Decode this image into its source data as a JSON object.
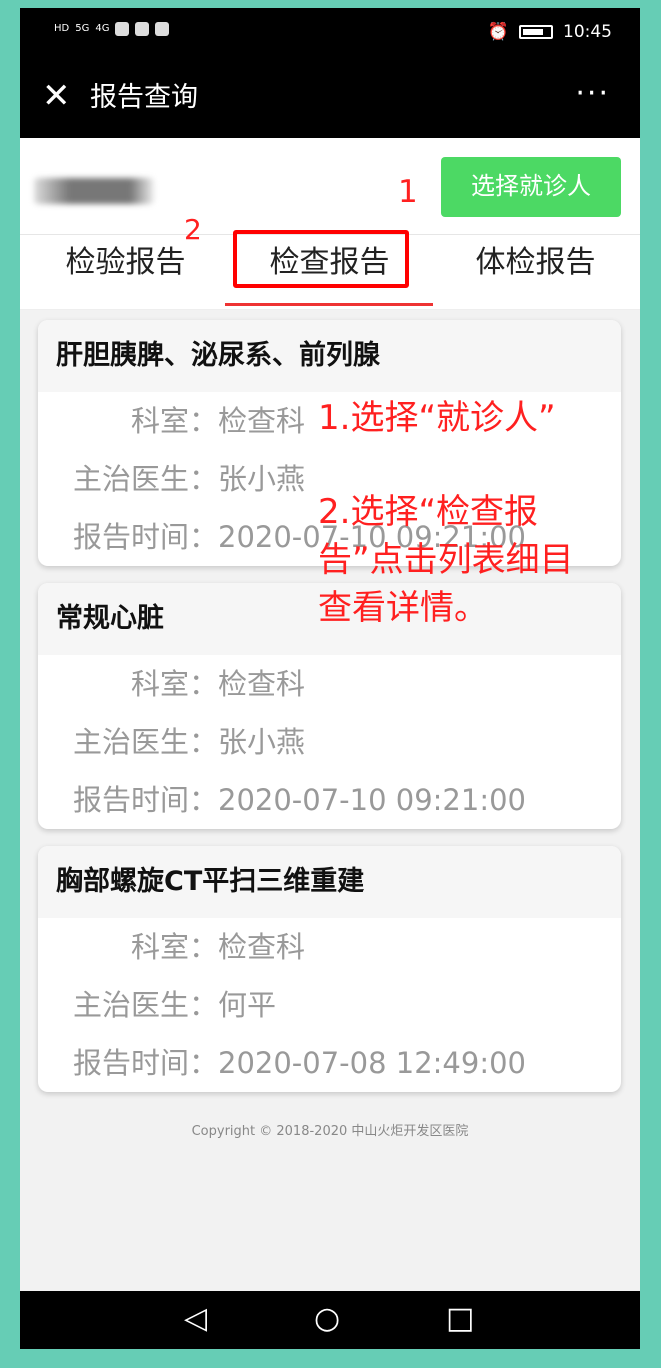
{
  "status_bar": {
    "left_icons": [
      "HD",
      "5G",
      "4G",
      "app",
      "app",
      "app"
    ],
    "time": "10:45",
    "alarm_icon": "alarm-icon"
  },
  "title_bar": {
    "close": "✕",
    "title": "报告查询",
    "more": "···"
  },
  "patient": {
    "select_button": "选择就诊人"
  },
  "annotations": {
    "num1": "1",
    "num2": "2",
    "note1": "1.选择“就诊人”",
    "note2_line1": "2.选择“检查报",
    "note2_line2": "告”点击列表细目",
    "note2_line3": "查看详情。"
  },
  "tabs": [
    "检验报告",
    "检查报告",
    "体检报告"
  ],
  "reports": [
    {
      "title": "肝胆胰脾、泌尿系、前列腺",
      "dept_label": "科室：",
      "dept": "检查科",
      "doctor_label": "主治医生：",
      "doctor": "张小燕",
      "time_label": "报告时间：",
      "time": "2020-07-10 09:21:00"
    },
    {
      "title": "常规心脏",
      "dept_label": "科室：",
      "dept": "检查科",
      "doctor_label": "主治医生：",
      "doctor": "张小燕",
      "time_label": "报告时间：",
      "time": "2020-07-10 09:21:00"
    },
    {
      "title": "胸部螺旋CT平扫三维重建",
      "dept_label": "科室：",
      "dept": "检查科",
      "doctor_label": "主治医生：",
      "doctor": "何平",
      "time_label": "报告时间：",
      "time": "2020-07-08 12:49:00"
    }
  ],
  "copyright": "Copyright © 2018-2020 中山火炬开发区医院",
  "nav": {
    "back": "◁",
    "home": "○",
    "recent": "□"
  },
  "colors": {
    "accent_green": "#4cd964",
    "annotation_red": "#ff2020",
    "frame": "#66cdb5"
  }
}
